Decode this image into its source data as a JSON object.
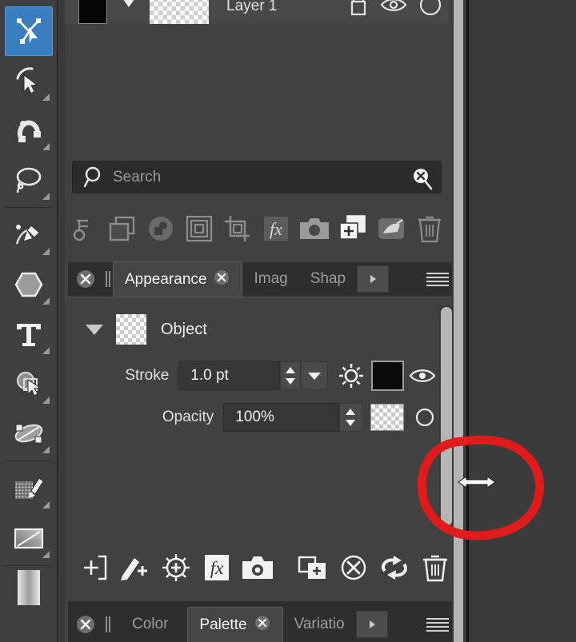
{
  "app": {
    "theme_bg": "#3b3b3b",
    "panel_bg": "#414141",
    "accent": "#3a7ec0",
    "annotation_color": "#e01b1b"
  },
  "toolbar": {
    "tools": [
      {
        "name": "direct-selection-tool",
        "label": "Direct Selection",
        "selected": true,
        "has_flyout": false
      },
      {
        "name": "selection-tool",
        "label": "Selection",
        "selected": false,
        "has_flyout": true
      },
      {
        "name": "magnetic-select-tool",
        "label": "Magnetic Select",
        "selected": false,
        "has_flyout": true
      },
      {
        "name": "lasso-tool",
        "label": "Lasso",
        "selected": false,
        "has_flyout": true
      },
      {
        "name": "pen-tool",
        "label": "Pen",
        "selected": false,
        "has_flyout": true
      },
      {
        "name": "shape-tool",
        "label": "Shape",
        "selected": false,
        "has_flyout": true
      },
      {
        "name": "type-tool",
        "label": "Type",
        "selected": false,
        "has_flyout": true
      },
      {
        "name": "node-edit-tool",
        "label": "Node Edit",
        "selected": false,
        "has_flyout": true
      },
      {
        "name": "mesh-warp-tool",
        "label": "Mesh Warp",
        "selected": false,
        "has_flyout": true
      },
      {
        "name": "paint-tool",
        "label": "Paint",
        "selected": false,
        "has_flyout": true
      },
      {
        "name": "gradient-tool",
        "label": "Gradient",
        "selected": false,
        "has_flyout": true
      },
      {
        "name": "pattern-tool",
        "label": "Pattern",
        "selected": false,
        "has_flyout": true
      }
    ]
  },
  "layers_panel": {
    "row": {
      "name": "Layer 1",
      "color_swatch": "#050505",
      "thumbnail": "transparent-checker",
      "right_icons": [
        "lock-icon",
        "eye-icon",
        "circle-icon"
      ]
    },
    "scrollbar": {
      "name": "layers-scrollbar"
    }
  },
  "search": {
    "placeholder": "Search",
    "value": "",
    "search_icon": "magnifier-icon",
    "clear_icon": "clear-search-icon"
  },
  "layer_toolbar": {
    "icons": [
      {
        "name": "link-layers-icon",
        "label": "Link"
      },
      {
        "name": "duplicate-layer-icon",
        "label": "Duplicate"
      },
      {
        "name": "mask-layer-icon",
        "label": "Mask"
      },
      {
        "name": "clip-layer-icon",
        "label": "Clip"
      },
      {
        "name": "crop-layer-icon",
        "label": "Crop"
      },
      {
        "name": "effects-fx-icon",
        "label": "fx"
      },
      {
        "name": "snapshot-camera-icon",
        "label": "Snapshot"
      },
      {
        "name": "new-layer-icon",
        "label": "New Layer",
        "highlighted": true
      },
      {
        "name": "merge-layers-icon",
        "label": "Merge"
      },
      {
        "name": "delete-layer-icon",
        "label": "Delete"
      }
    ]
  },
  "top_tabs": {
    "close_icon": "close-panel-icon",
    "grip": "drag-grip",
    "items": [
      {
        "name": "tab-appearance",
        "label": "Appearance",
        "active": true,
        "closable": true
      },
      {
        "name": "tab-image",
        "label": "Imag",
        "active": false,
        "closable": false
      },
      {
        "name": "tab-shape",
        "label": "Shap",
        "active": false,
        "closable": false
      }
    ],
    "next_icon": "chevron-right-icon",
    "menu_icon": "hamburger-menu-icon"
  },
  "appearance": {
    "object": {
      "label": "Object",
      "expanded": true,
      "thumbnail": "transparent-checker",
      "disclosure_icon": "triangle-down-icon"
    },
    "fields": [
      {
        "name": "stroke",
        "label": "Stroke",
        "value": "1.0 pt",
        "spinner_icon": "up-down-spinner-icon",
        "dropdown_icon": "chevron-down-icon",
        "gear_icon": "gear-icon",
        "swatch": "#0b0b0b",
        "visibility_icon": "eye-icon"
      },
      {
        "name": "opacity",
        "label": "Opacity",
        "value": "100%",
        "spinner_icon": "up-down-spinner-icon",
        "swatch": "transparent-checker",
        "visibility_icon": "circle-icon"
      }
    ],
    "scrollbar": {
      "name": "appearance-scrollbar"
    }
  },
  "appearance_toolbar": {
    "icons": [
      {
        "name": "add-new-stroke-icon",
        "label": "Add Stroke"
      },
      {
        "name": "add-new-fill-icon",
        "label": "Add Fill"
      },
      {
        "name": "add-adjustment-icon",
        "label": "Add Adjustment"
      },
      {
        "name": "add-effect-fx-icon",
        "label": "Add Effect",
        "highlighted": true
      },
      {
        "name": "snapshot-camera-icon",
        "label": "Snapshot"
      },
      {
        "name": "duplicate-item-icon",
        "label": "Duplicate Item"
      },
      {
        "name": "clear-appearance-icon",
        "label": "Clear Appearance"
      },
      {
        "name": "reset-appearance-icon",
        "label": "Reset Appearance"
      },
      {
        "name": "delete-item-icon",
        "label": "Delete Item"
      }
    ]
  },
  "bottom_tabs": {
    "close_icon": "close-panel-icon",
    "grip": "drag-grip",
    "items": [
      {
        "name": "tab-color",
        "label": "Color",
        "active": false,
        "closable": false
      },
      {
        "name": "tab-palette",
        "label": "Palette",
        "active": true,
        "closable": true
      },
      {
        "name": "tab-variations",
        "label": "Variatio",
        "active": false,
        "closable": false
      }
    ],
    "next_icon": "chevron-right-icon",
    "menu_icon": "hamburger-menu-icon"
  },
  "panel_edge": {
    "resize_cursor": "horizontal-resize-cursor",
    "annotation": "red-circle-highlight",
    "scrollbar": "panel-vertical-scrollbar"
  }
}
